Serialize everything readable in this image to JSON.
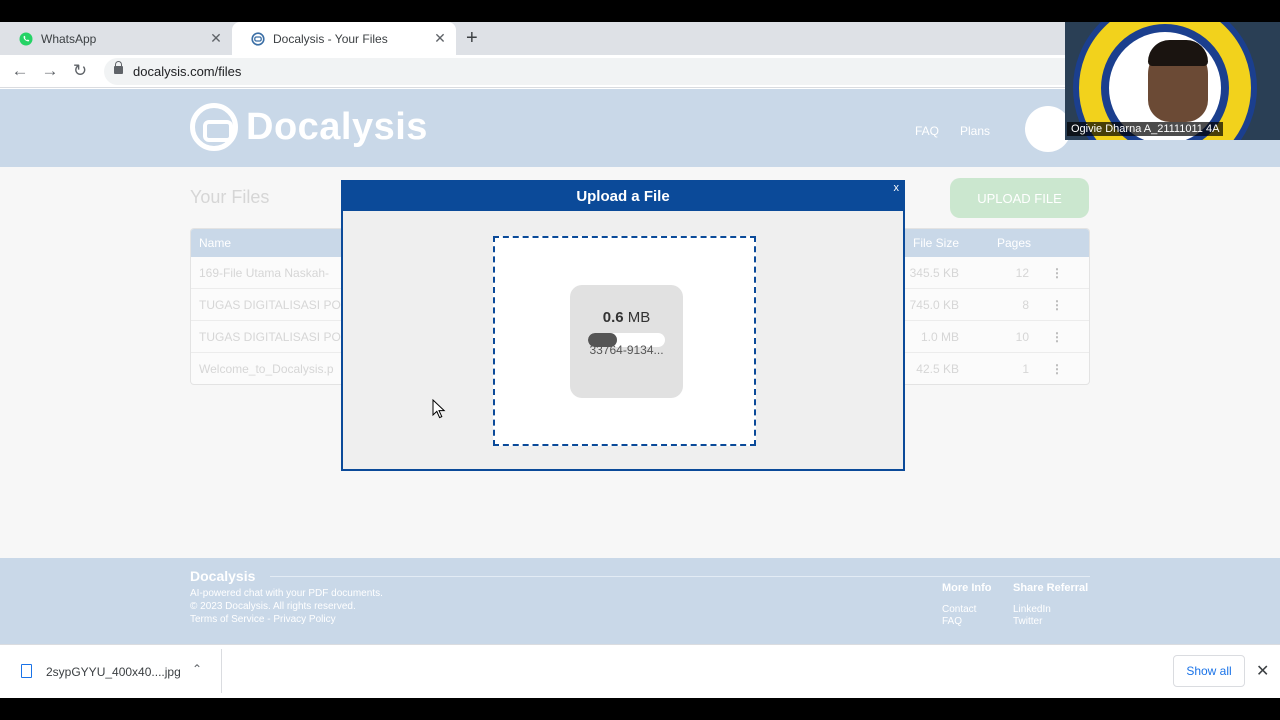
{
  "browser": {
    "tabs": [
      {
        "title": "WhatsApp",
        "icon": "whatsapp-icon"
      },
      {
        "title": "Docalysis - Your Files",
        "icon": "docalysis-icon"
      }
    ],
    "url": "docalysis.com/files"
  },
  "site": {
    "brand": "Docalysis",
    "nav": {
      "faq": "FAQ",
      "plans": "Plans"
    },
    "files_title": "Your Files",
    "upload_button": "UPLOAD FILE",
    "table": {
      "headers": {
        "name": "Name",
        "size": "File Size",
        "pages": "Pages"
      },
      "rows": [
        {
          "name": "169-File Utama Naskah-",
          "size": "345.5 KB",
          "pages": "12"
        },
        {
          "name": "TUGAS DIGITALISASI PO",
          "size": "745.0 KB",
          "pages": "8"
        },
        {
          "name": "TUGAS DIGITALISASI PO",
          "size": "1.0 MB",
          "pages": "10"
        },
        {
          "name": "Welcome_to_Docalysis.p",
          "size": "42.5 KB",
          "pages": "1"
        }
      ]
    }
  },
  "modal": {
    "title": "Upload a File",
    "close": "x",
    "file": {
      "size_value": "0.6",
      "size_unit": "MB",
      "name": "33764-9134...",
      "progress": 0.38
    }
  },
  "footer": {
    "brand": "Docalysis",
    "tagline": "AI-powered chat with your PDF documents.",
    "copyright": "© 2023 Docalysis. All rights reserved.",
    "legal": "Terms of Service - Privacy Policy",
    "more_info": {
      "heading": "More Info",
      "links": [
        "Contact",
        "FAQ"
      ]
    },
    "share": {
      "heading": "Share Referral",
      "links": [
        "LinkedIn",
        "Twitter"
      ]
    }
  },
  "downloads": {
    "file": "2sypGYYU_400x40....jpg",
    "show_all": "Show all"
  },
  "webcam": {
    "name": "Ogivie Dharna A_21111011 4A"
  },
  "colors": {
    "modal_blue": "#0b4a99",
    "header_blue": "#c9d8e8",
    "upload_green": "#cbe7cf"
  }
}
